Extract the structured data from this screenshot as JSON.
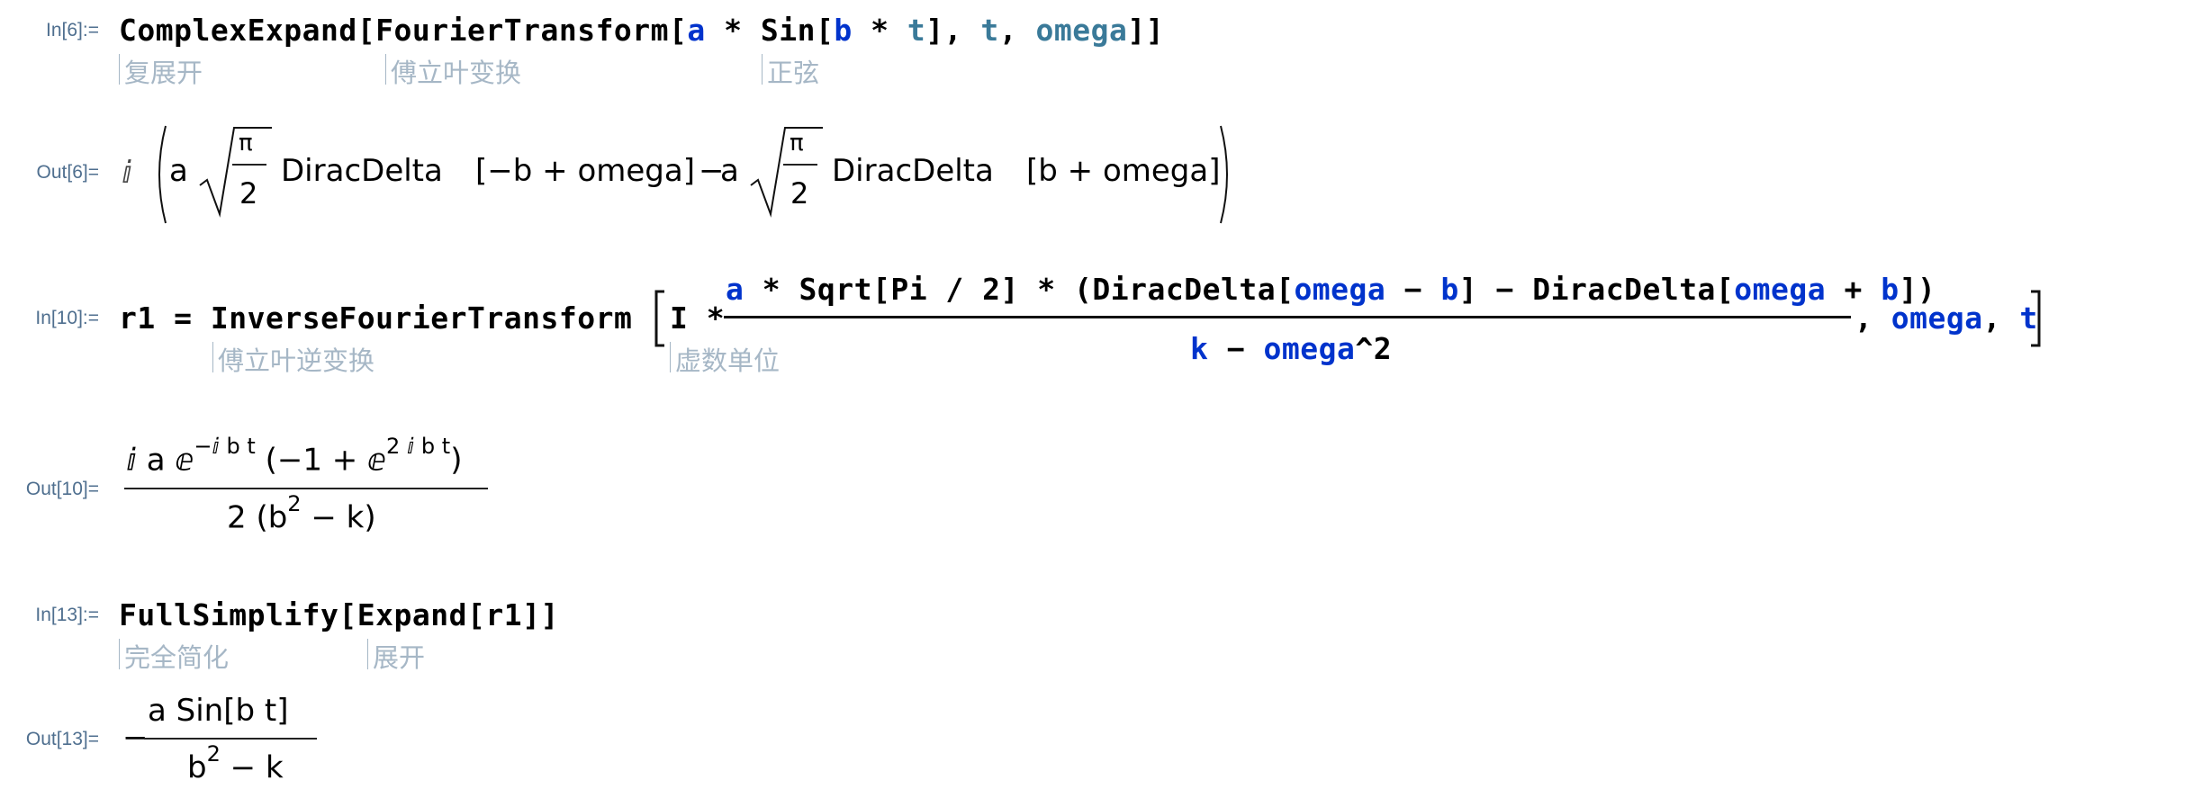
{
  "cells": {
    "in6": {
      "label": "In[6]:=",
      "code": {
        "complexexpand": "ComplexExpand",
        "lb1": "[",
        "fouriertransform": "FourierTransform",
        "lb2": "[",
        "a": "a",
        "star1": " * ",
        "sin": "Sin",
        "lb3": "[",
        "b": "b",
        "star2": " * ",
        "t": "t",
        "rb3": "]",
        "comma1": ", ",
        "t2": "t",
        "comma2": ", ",
        "omega": "omega",
        "rb": "]]"
      },
      "hints": [
        "复展开",
        "傅立叶变换",
        "正弦"
      ]
    },
    "out6": {
      "label": "Out[6]=",
      "i": "ⅈ",
      "a1": "a",
      "pi1": "π",
      "two1": "2",
      "dirac1": "DiracDelta",
      "arg1": "[−b + omega]",
      "minus": "−",
      "a2": "a",
      "pi2": "π",
      "two2": "2",
      "dirac2": "DiracDelta",
      "arg2": "[b + omega]"
    },
    "in10": {
      "label": "In[10]:=",
      "r1": "r1",
      "eq": " = ",
      "ift": "InverseFourierTransform",
      "I": "I",
      "star": " * ",
      "num": {
        "a": "a",
        "star1": " * ",
        "sqrt": "Sqrt[Pi / 2]",
        "star2": " * ",
        "open": "(",
        "dd1": "DiracDelta[",
        "om1": "omega",
        "minus": " − ",
        "b1": "b",
        "close1": "]",
        "minus2": " − ",
        "dd2": "DiracDelta[",
        "om2": "omega",
        "plus": " + ",
        "b2": "b",
        "close2": "])"
      },
      "den": {
        "k": "k",
        "minus": " − ",
        "omega": "omega",
        "pow": "^2"
      },
      "comma1": ", ",
      "omega": "omega",
      "comma2": ", ",
      "t": "t",
      "hints": [
        "傅立叶逆变换",
        "虚数单位"
      ]
    },
    "out10": {
      "label": "Out[10]=",
      "num_main": "ⅈ a ⅇ",
      "num_exp1": "−ⅈ b t",
      "num_paren": "(−1 + ⅇ",
      "num_exp2": "2 ⅈ b t",
      "num_close": ")",
      "den_main": "2 (b",
      "den_exp": "2",
      "den_rest": " − k)"
    },
    "in13": {
      "label": "In[13]:=",
      "fullsimplify": "FullSimplify",
      "lb1": "[",
      "expand": "Expand",
      "lb2": "[",
      "r1": "r1",
      "rb": "]]",
      "hints": [
        "完全简化",
        "展开"
      ]
    },
    "out13": {
      "label": "Out[13]=",
      "minus": "−",
      "num": "a Sin[b t]",
      "den_b": "b",
      "den_exp": "2",
      "den_rest": " − k"
    }
  },
  "colors": {
    "label": "#4f6f8f",
    "symbol_blue": "#0033cc",
    "symbol_teal": "#3a7a99",
    "hint": "#a6b7c6"
  }
}
